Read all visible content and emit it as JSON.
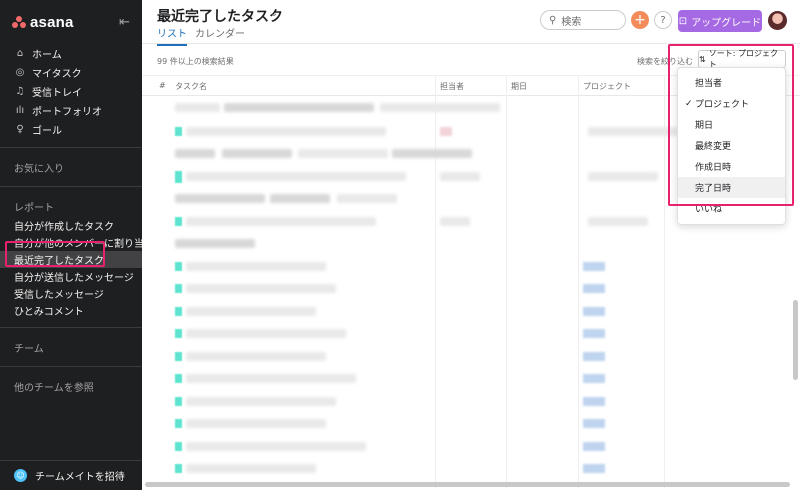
{
  "brand": {
    "logo_text": "asana"
  },
  "sidebar": {
    "collapse_icon": "collapse-sidebar-icon",
    "nav": [
      {
        "label": "ホーム",
        "icon": "home-icon"
      },
      {
        "label": "マイタスク",
        "icon": "check-circle-icon"
      },
      {
        "label": "受信トレイ",
        "icon": "bell-icon"
      },
      {
        "label": "ポートフォリオ",
        "icon": "bar-chart-icon"
      },
      {
        "label": "ゴール",
        "icon": "person-icon"
      }
    ],
    "favorites_title": "お気に入り",
    "reports_title": "レポート",
    "reports": [
      {
        "label": "自分が作成したタスク",
        "active": false
      },
      {
        "label": "自分が他のメンバーに割り当...",
        "active": false
      },
      {
        "label": "最近完了したタスク",
        "active": true
      },
      {
        "label": "自分が送信したメッセージ",
        "active": false
      },
      {
        "label": "受信したメッセージ",
        "active": false
      },
      {
        "label": "ひとみコメント",
        "active": false
      }
    ],
    "teams_title": "チーム",
    "browse_teams": "他のチームを参照",
    "invite_label": "チームメイトを招待"
  },
  "header": {
    "title": "最近完了したタスク",
    "tabs": [
      {
        "label": "リスト",
        "active": true
      },
      {
        "label": "カレンダー",
        "active": false
      }
    ],
    "search_placeholder": "検索",
    "help_label": "?",
    "upgrade_label": "アップグレード"
  },
  "toolbar": {
    "result_count": "99 件以上の検索結果",
    "refine_label": "検索を絞り込む",
    "sort_label": "ソート: プロジェクト"
  },
  "table": {
    "columns": [
      "#",
      "タスク名",
      "担当者",
      "期日",
      "プロジェクト"
    ]
  },
  "sort_menu": {
    "options": [
      {
        "label": "担当者",
        "selected": false
      },
      {
        "label": "プロジェクト",
        "selected": true
      },
      {
        "label": "期日",
        "selected": false
      },
      {
        "label": "最終変更",
        "selected": false
      },
      {
        "label": "作成日時",
        "selected": false
      },
      {
        "label": "完了日時",
        "selected": false,
        "hover": true
      },
      {
        "label": "いいね",
        "selected": false
      }
    ]
  },
  "colors": {
    "sidebar_bg": "#1e1f21",
    "accent_pink": "#e8216f",
    "upgrade_purple": "#a569e3",
    "plus_orange": "#f38b5b",
    "tab_blue": "#1e70b8"
  }
}
